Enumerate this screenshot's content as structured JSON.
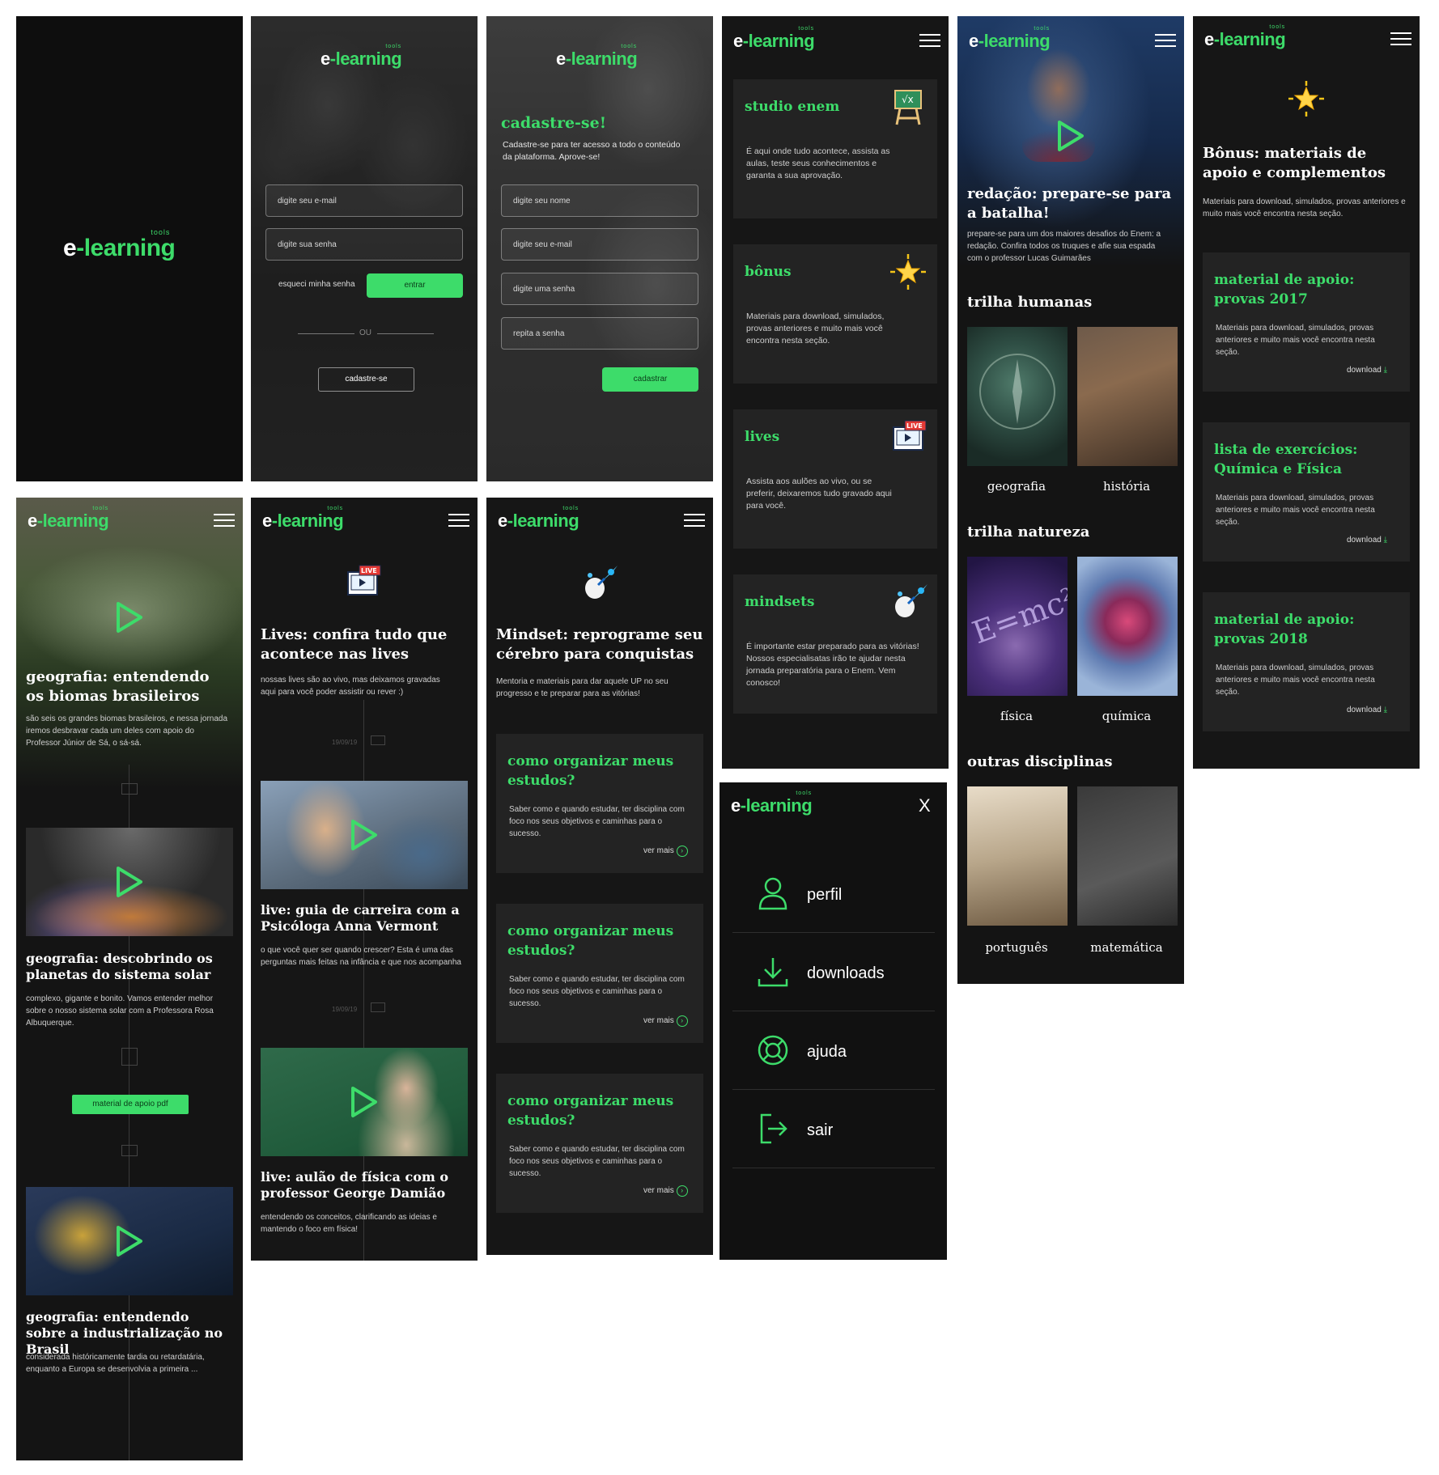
{
  "brand": {
    "name_left": "e",
    "name_dash": "-",
    "name_right": "learning",
    "sub": "tools"
  },
  "login": {
    "email_placeholder": "digite seu e-mail",
    "password_placeholder": "digite sua senha",
    "forgot": "esqueci minha senha",
    "enter": "entrar",
    "or": "OU",
    "signup": "cadastre-se"
  },
  "signup": {
    "title": "cadastre-se!",
    "subtitle": "Cadastre-se para ter acesso a todo o conteúdo da plataforma. Aprove-se!",
    "name_placeholder": "digite seu nome",
    "email_placeholder": "digite seu e-mail",
    "password_placeholder": "digite uma senha",
    "repeat_placeholder": "repita a senha",
    "submit": "cadastrar"
  },
  "home": {
    "cards": [
      {
        "title": "studio enem",
        "text": "É aqui onde tudo acontece, assista as aulas, teste seus conhecimentos e garanta a sua aprovação.",
        "icon": "chalkboard-icon"
      },
      {
        "title": "bônus",
        "text": "Materiais para download, simulados, provas anteriores e muito mais você encontra nesta seção.",
        "icon": "star-icon"
      },
      {
        "title": "lives",
        "text": "Assista aos aulões ao vivo, ou se preferir, deixaremos tudo gravado aqui para você.",
        "icon": "live-icon"
      },
      {
        "title": "mindsets",
        "text": "É importante estar preparado para as vitórias! Nossos especialisatas irão te ajudar nesta jornada preparatória para o Enem. Vem conosco!",
        "icon": "rocket-head-icon"
      }
    ]
  },
  "redacao": {
    "title": "redação: prepare-se para a batalha!",
    "text": "prepare-se para um dos maiores desafios do Enem: a redação. Confira todos os truques e afie sua espada com o professor Lucas Guimarães",
    "sections": [
      {
        "title": "trilha humanas",
        "items": [
          "geografia",
          "história"
        ]
      },
      {
        "title": "trilha natureza",
        "items": [
          "física",
          "química"
        ]
      },
      {
        "title": "outras disciplinas",
        "items": [
          "português",
          "matemática"
        ]
      }
    ]
  },
  "bonus": {
    "title": "Bônus: materiais de apoio e complementos",
    "text": "Materiais para download, simulados, provas anteriores e muito mais você encontra nesta seção.",
    "cards": [
      {
        "title": "material de apoio: provas 2017",
        "text": "Materiais para download, simulados, provas anteriores e muito mais você encontra nesta seção.",
        "action": "download"
      },
      {
        "title": "lista de exercícios: Química e Física",
        "text": "Materiais para download, simulados, provas anteriores e muito mais você encontra nesta seção.",
        "action": "download"
      },
      {
        "title": "material de apoio: provas 2018",
        "text": "Materiais para download, simulados, provas anteriores e muito mais você encontra nesta seção.",
        "action": "download"
      }
    ]
  },
  "geo": {
    "title": "geografia: entendendo os biomas brasileiros",
    "text": "são seis os grandes biomas brasileiros, e nessa jornada iremos desbravar cada um deles com apoio do Professor Júnior de Sá, o sá-sá.",
    "items": [
      {
        "title": "geografia: descobrindo os planetas do sistema solar",
        "text": "complexo, gigante e bonito. Vamos entender melhor sobre o nosso sistema solar com a Professora Rosa Albuquerque."
      },
      {
        "title": "geografia: entendendo sobre a industrialização no Brasil",
        "text": "considerada históricamente tardia ou retardatária, enquanto a Europa se desenvolvia a primeira ..."
      }
    ],
    "pdf": "material de apoio pdf"
  },
  "lives": {
    "title": "Lives: confira tudo que acontece nas lives",
    "text": "nossas lives são ao vivo, mas deixamos gravadas aqui para você poder assistir ou rever :)",
    "items": [
      {
        "date": "19/09/19",
        "title": "live: guia de carreira com a Psicóloga Anna Vermont",
        "text": "o que você quer ser quando crescer? Esta é uma das perguntas mais feitas na infância e que nos acompanha"
      },
      {
        "date": "19/09/19",
        "title": "live: aulão de física com o professor George Damião",
        "text": "entendendo os conceitos, clarificando as ideias e mantendo o foco em física!"
      }
    ]
  },
  "mindset": {
    "title": "Mindset: reprograme seu cérebro para conquistas",
    "text": "Mentoria e materiais para dar aquele UP no seu progresso e te preparar para as vitórias!",
    "cards": [
      {
        "title": "como organizar meus estudos?",
        "text": "Saber como e quando estudar, ter disciplina com foco nos seus objetivos e caminhas para o sucesso.",
        "more": "ver mais"
      },
      {
        "title": "como organizar meus estudos?",
        "text": "Saber como e quando estudar, ter disciplina com foco nos seus objetivos e caminhas para o sucesso.",
        "more": "ver mais"
      },
      {
        "title": "como organizar meus estudos?",
        "text": "Saber como e quando estudar, ter disciplina com foco nos seus objetivos e caminhas para o sucesso.",
        "more": "ver mais"
      }
    ]
  },
  "menu": {
    "close": "X",
    "items": [
      "perfil",
      "downloads",
      "ajuda",
      "sair"
    ]
  },
  "colors": {
    "accent": "#3ddc6a",
    "bg": "#121212",
    "card": "#232323"
  }
}
